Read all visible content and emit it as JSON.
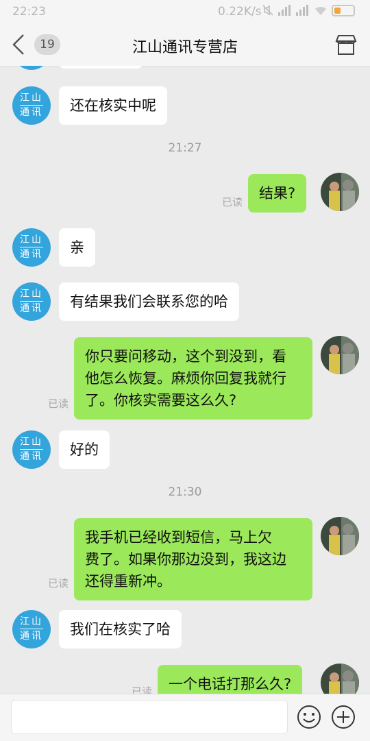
{
  "status_bar": {
    "time": "22:23",
    "net_speed": "0.22K/s"
  },
  "header": {
    "unread_count": "19",
    "title": "江山通讯专营店"
  },
  "shop_avatar": {
    "line1": "江山",
    "line2": "通讯"
  },
  "messages": [
    {
      "text": "还在核实中呢"
    },
    {
      "timestamp": "21:27"
    },
    {
      "text": "结果?",
      "read": "已读"
    },
    {
      "text": "亲"
    },
    {
      "text": "有结果我们会联系您的哈"
    },
    {
      "text": "你只要问移动，这个到没到，看\n他怎么恢复。麻烦你回复我就行\n了。你核实需要这么久?",
      "read": "已读"
    },
    {
      "text": "好的"
    },
    {
      "timestamp": "21:30"
    },
    {
      "text": "我手机已经收到短信，马上欠\n费了。如果你那边没到，我这边\n还得重新冲。",
      "read": "已读"
    },
    {
      "text": "我们在核实了哈"
    },
    {
      "text": "一个电话打那么久?",
      "read": "已读"
    }
  ],
  "input": {
    "placeholder": ""
  },
  "icons": [
    "back-icon",
    "shop-icon",
    "emoji-icon",
    "plus-icon"
  ],
  "colors": {
    "outgoing_bubble": "#9be85a",
    "shop_avatar": "#33a5dc",
    "background": "#ebebeb"
  }
}
